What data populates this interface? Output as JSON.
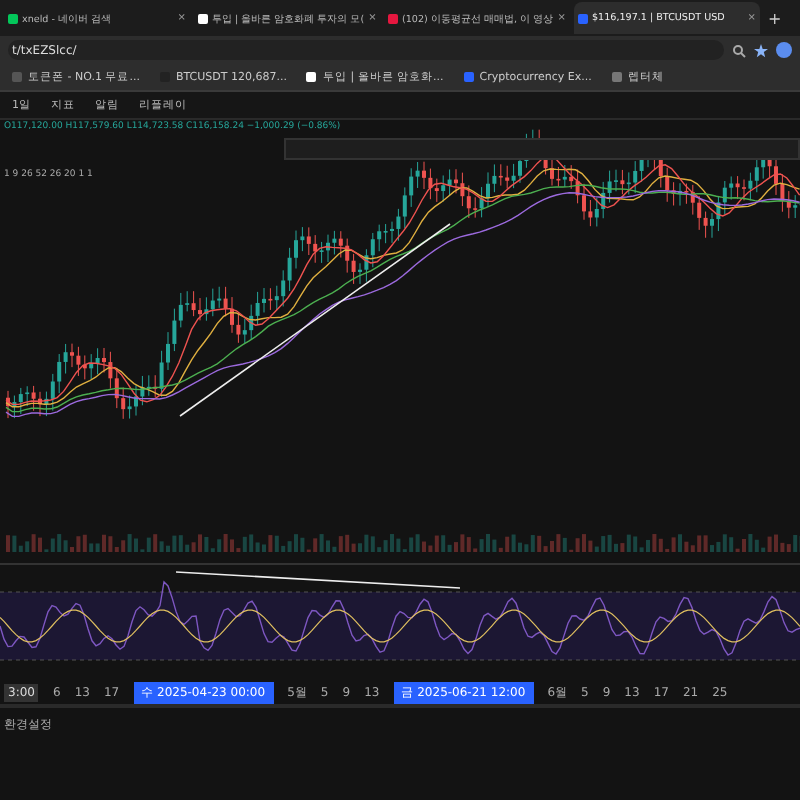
{
  "tabs": [
    {
      "label": "xneld - 네이버 검색",
      "color": "#03c75a",
      "selected": false
    },
    {
      "label": "투입 | 올바른 암호화폐 투자의 모(",
      "color": "#ffffff",
      "selected": false
    },
    {
      "label": "(102) 이동평균선 매매법, 이 영상",
      "color": "#e5173f",
      "selected": false
    },
    {
      "label": "$116,197.1 | BTCUSDT USD",
      "color": "#2962ff",
      "selected": true
    }
  ],
  "tab_close": "×",
  "new_tab": "+",
  "address": {
    "value": "t/txEZSlcc/"
  },
  "bookmarks": [
    {
      "label": "토큰폰 - NO.1 무료...",
      "color": "#555555"
    },
    {
      "label": "BTCUSDT 120,687...",
      "color": "#222222"
    },
    {
      "label": "투입 | 올바른 암호화...",
      "color": "#ffffff"
    },
    {
      "label": "Cryptocurrency Ex...",
      "color": "#2962ff"
    },
    {
      "label": "렙터체",
      "color": "#777777"
    }
  ],
  "toolbar": {
    "interval": "1일",
    "items": [
      "지표",
      "알림",
      "리플레이"
    ]
  },
  "ohlc": "O117,120.00 H117,579.60 L114,723.58 C116,158.24 −1,000.29 (−0.86%)",
  "indicator": "1 9 26 52 26 20 1 1",
  "time_axis": {
    "start": "3:00",
    "labels": [
      "6",
      "13",
      "17"
    ],
    "marker1": "수 2025-04-23 00:00",
    "mid": [
      "5월",
      "5",
      "9",
      "13"
    ],
    "marker2": "금 2025-06-21 12:00",
    "end": [
      "6월",
      "5",
      "9",
      "13",
      "17",
      "21",
      "25"
    ]
  },
  "footer": "환경설정"
}
